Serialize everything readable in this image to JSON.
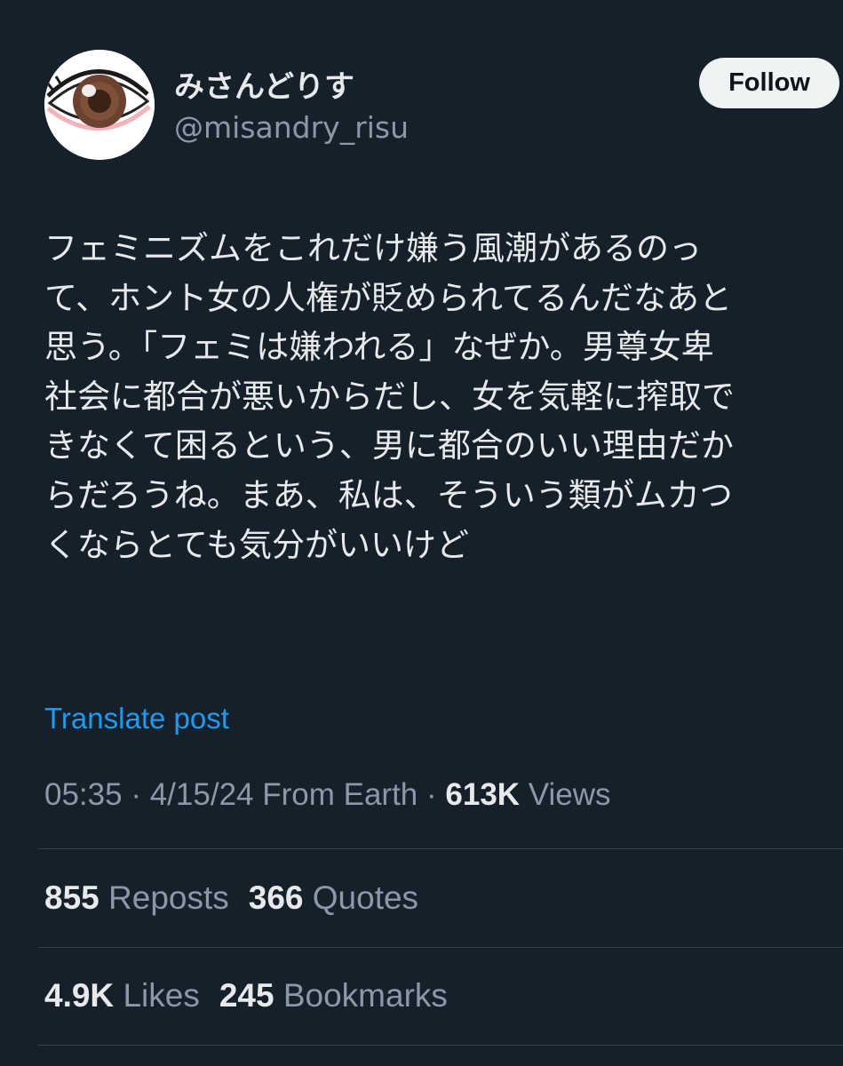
{
  "author": {
    "display_name": "みさんどりす",
    "handle": "@misandry_risu",
    "avatar_icon": "eye-icon"
  },
  "follow_button": {
    "label": "Follow"
  },
  "post": {
    "lines": [
      "フェミニズムをこれだけ嫌う風潮があるのっ",
      "て、ホント女の人権が貶められてるんだなあと",
      "思う。「フェミは嫌われる」なぜか。男尊女卑",
      "社会に都合が悪いからだし、女を気軽に搾取で",
      "きなくて困るという、男に都合のいい理由だか",
      "らだろうね。まあ、私は、そういう類がムカつ",
      "くならとても気分がいいけど"
    ],
    "translate_label": "Translate post"
  },
  "meta": {
    "time": "05:35",
    "separator": "·",
    "date_location": "4/15/24 From Earth",
    "views_count": "613K",
    "views_label": "Views"
  },
  "stats": {
    "reposts_count": "855",
    "reposts_label": "Reposts",
    "quotes_count": "366",
    "quotes_label": "Quotes",
    "likes_count": "4.9K",
    "likes_label": "Likes",
    "bookmarks_count": "245",
    "bookmarks_label": "Bookmarks"
  },
  "colors": {
    "background": "#15202b",
    "text": "#e7e9ea",
    "secondary_text": "#8b98a5",
    "link": "#1d9bf0",
    "divider": "#38444d",
    "button_bg": "#eff3f4"
  }
}
